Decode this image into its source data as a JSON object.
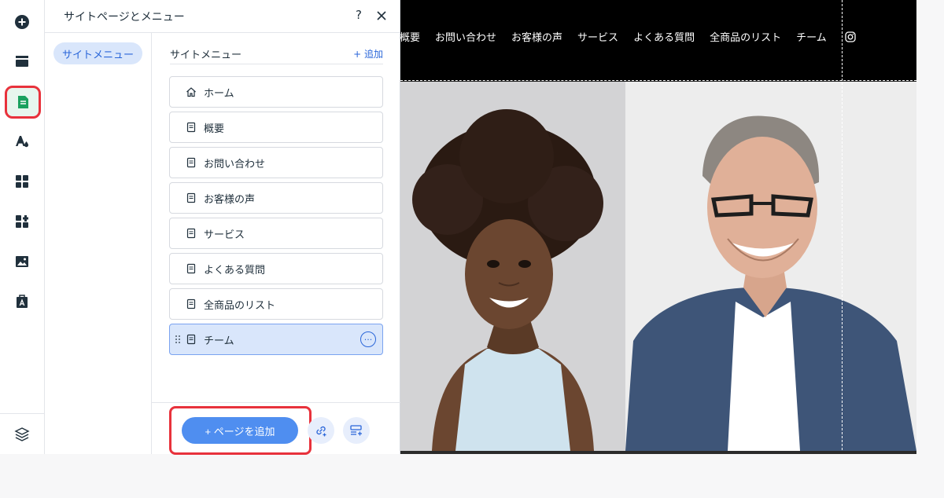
{
  "panel": {
    "title": "サイトページとメニュー",
    "help": "?",
    "left_tab": "サイトメニュー",
    "section_title": "サイトメニュー",
    "add_link": "+ 追加",
    "pages": [
      {
        "label": "ホーム",
        "icon": "home-icon"
      },
      {
        "label": "概要",
        "icon": "page-icon"
      },
      {
        "label": "お問い合わせ",
        "icon": "page-icon"
      },
      {
        "label": "お客様の声",
        "icon": "page-icon"
      },
      {
        "label": "サービス",
        "icon": "page-icon"
      },
      {
        "label": "よくある質問",
        "icon": "page-icon"
      },
      {
        "label": "全商品のリスト",
        "icon": "page-icon"
      },
      {
        "label": "チーム",
        "icon": "page-icon",
        "selected": true
      }
    ],
    "more": "···",
    "add_page_button": "+ ページを追加"
  },
  "toolbar": {
    "items": [
      "add-elements-icon",
      "sections-icon",
      "pages-icon",
      "design-icon",
      "apps-icon",
      "business-apps-icon",
      "media-icon",
      "portfolio-icon"
    ],
    "bottom": "layers-icon"
  },
  "site": {
    "nav": [
      "概要",
      "お問い合わせ",
      "お客様の声",
      "サービス",
      "よくある質問",
      "全商品のリスト",
      "チーム"
    ],
    "social": "instagram-icon"
  },
  "colors": {
    "accent_blue": "#2a66d9",
    "button_blue": "#4f8ef0",
    "highlight_red": "#e8323c",
    "selected_bg": "#d9e6fb",
    "active_tool_green": "#1aa15f"
  }
}
